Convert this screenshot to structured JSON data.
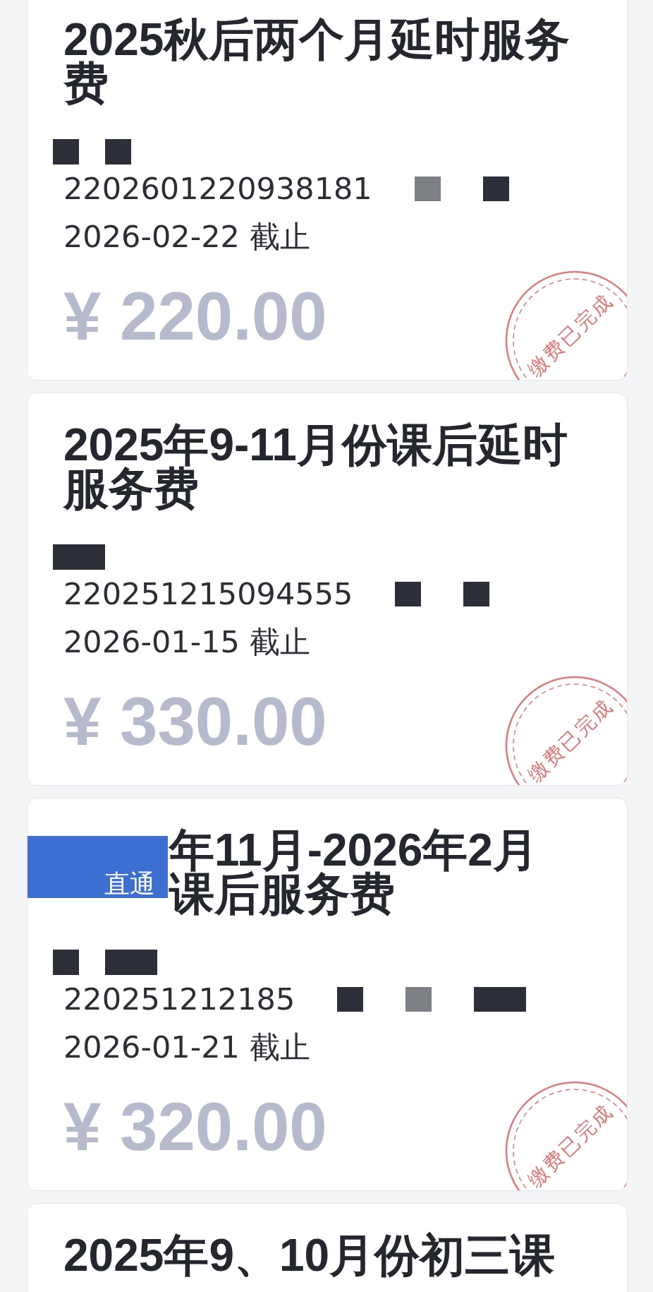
{
  "cards": [
    {
      "title": "2025秋后两个月延时服务费",
      "name_masks": [
        {
          "kind": "short",
          "color": "#2c2f37"
        },
        {
          "kind": "short",
          "color": "#2c2f37"
        }
      ],
      "order_no": "2202601220938181",
      "order_masks": [
        {
          "kind": "short",
          "color": "#7d8084"
        },
        {
          "kind": "short",
          "color": "#2c2f37"
        }
      ],
      "deadline": "2026-02-22 截止",
      "amount": "¥ 220.00",
      "stamp": "缴费已完成"
    },
    {
      "title": "2025年9-11月份课后延时服务费",
      "name_masks": [
        {
          "kind": "long",
          "color": "#2c2f37"
        }
      ],
      "order_no": "220251215094555",
      "order_masks": [
        {
          "kind": "short",
          "color": "#2c2f37"
        },
        {
          "kind": "short",
          "color": "#2c2f37"
        }
      ],
      "deadline": "2026-01-15 截止",
      "amount": "¥ 330.00",
      "stamp": "缴费已完成"
    },
    {
      "cover": {
        "label": "直通"
      },
      "title": "年11月-2026年2月课后服务费",
      "name_masks": [
        {
          "kind": "short",
          "color": "#2c2f37"
        },
        {
          "kind": "long",
          "color": "#2c2f37"
        }
      ],
      "order_no": "220251212185",
      "order_masks": [
        {
          "kind": "short",
          "color": "#2c2f37"
        },
        {
          "kind": "short",
          "color": "#7d8084"
        },
        {
          "kind": "long",
          "color": "#2c2f37"
        }
      ],
      "deadline": "2026-01-21 截止",
      "amount": "¥ 320.00",
      "stamp": "缴费已完成"
    },
    {
      "title": "2025年9、10月份初三课"
    }
  ]
}
